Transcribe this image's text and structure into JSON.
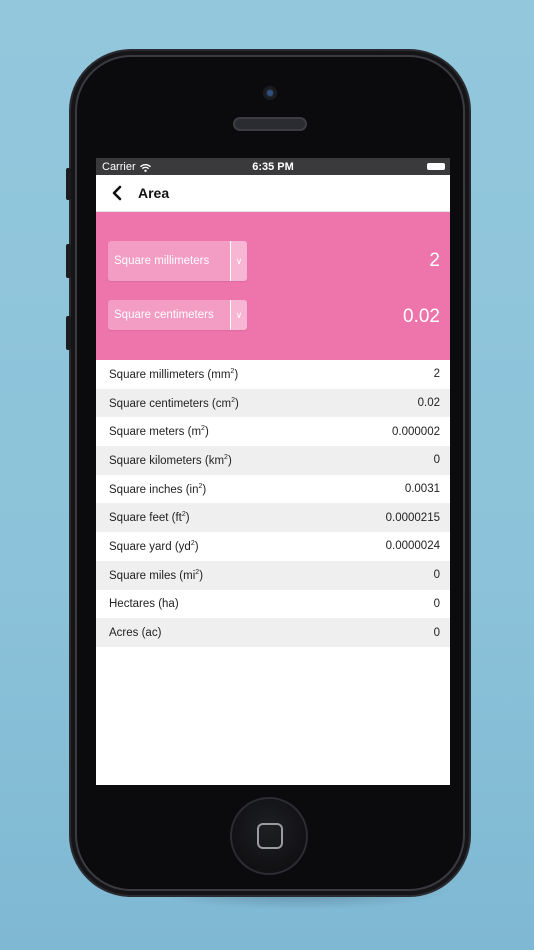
{
  "status_bar": {
    "carrier": "Carrier",
    "time": "6:35 PM"
  },
  "nav": {
    "title": "Area",
    "back_icon": "chevron-left-icon"
  },
  "converter": {
    "from_unit": "Square millimeters",
    "from_value": "2",
    "to_unit": "Square centimeters",
    "to_value": "0.02",
    "dropdown_icon": "chevron-down-icon",
    "accent_color": "#ee74ac"
  },
  "results": [
    {
      "name": "Square millimeters (mm",
      "sup": "2",
      "close": ")",
      "value": "2"
    },
    {
      "name": "Square centimeters (cm",
      "sup": "2",
      "close": ")",
      "value": "0.02"
    },
    {
      "name": "Square meters (m",
      "sup": "2",
      "close": ")",
      "value": "0.000002"
    },
    {
      "name": "Square kilometers (km",
      "sup": "2",
      "close": ")",
      "value": "0"
    },
    {
      "name": "Square inches (in",
      "sup": "2",
      "close": ")",
      "value": "0.0031"
    },
    {
      "name": "Square feet (ft",
      "sup": "2",
      "close": ")",
      "value": "0.0000215"
    },
    {
      "name": "Square yard (yd",
      "sup": "2",
      "close": ")",
      "value": "0.0000024"
    },
    {
      "name": "Square miles (mi",
      "sup": "2",
      "close": ")",
      "value": "0"
    },
    {
      "name": "Hectares (ha)",
      "sup": "",
      "close": "",
      "value": "0"
    },
    {
      "name": "Acres (ac)",
      "sup": "",
      "close": "",
      "value": "0"
    }
  ]
}
